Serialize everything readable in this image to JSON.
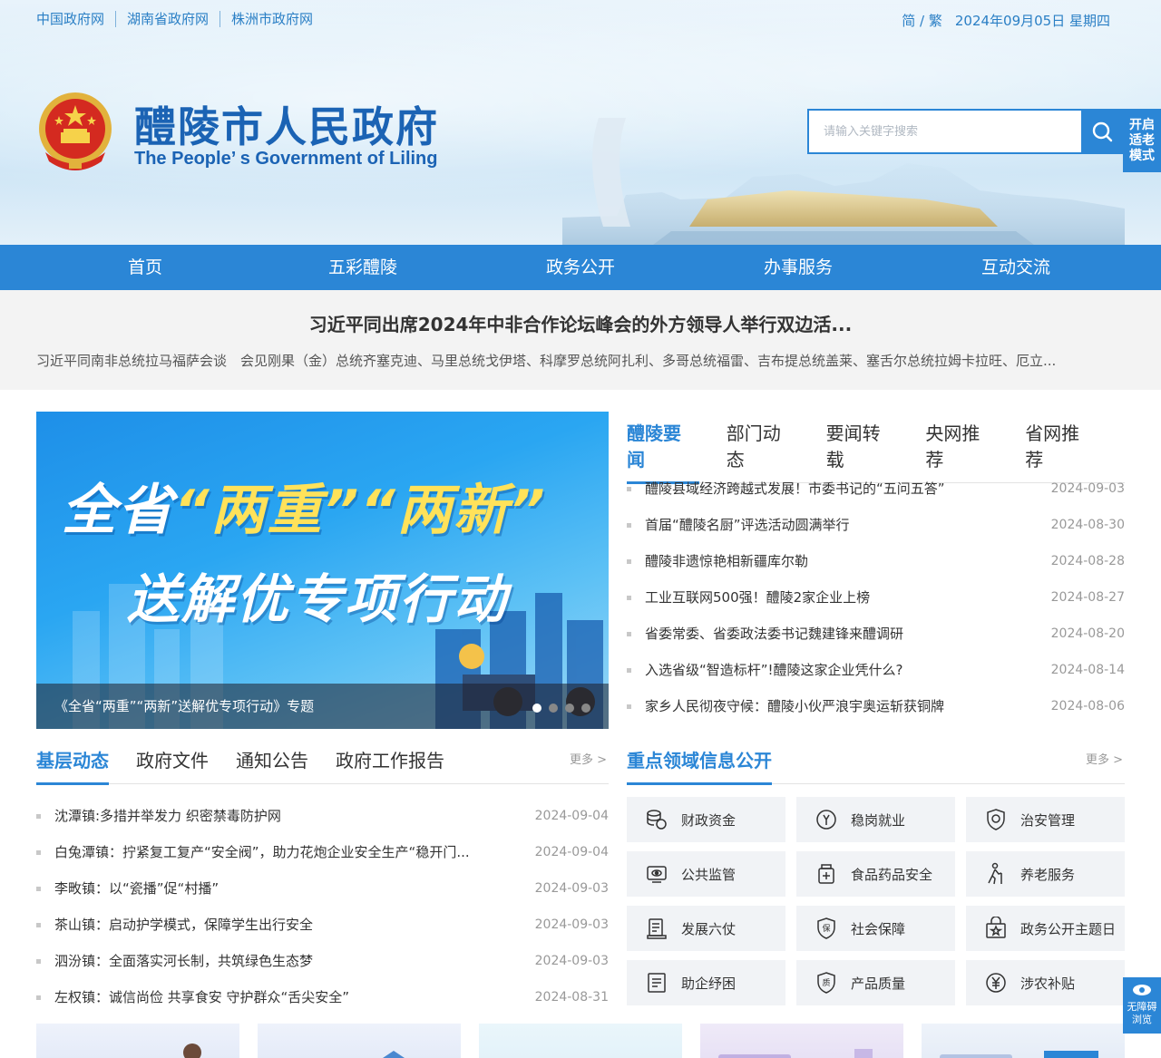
{
  "topbar": {
    "links": [
      "中国政府网",
      "湖南省政府网",
      "株洲市政府网"
    ],
    "lang": "简 / 繁",
    "date": "2024年09月05日 星期四"
  },
  "site": {
    "title_cn": "醴陵市人民政府",
    "title_en": "The People’ s Government of Liling"
  },
  "search": {
    "placeholder": "请输入关键字搜索",
    "icon": "search-icon"
  },
  "elder_mode": {
    "lines": [
      "开启",
      "适老",
      "模式"
    ]
  },
  "nav": [
    "首页",
    "五彩醴陵",
    "政务公开",
    "办事服务",
    "互动交流"
  ],
  "headline": {
    "title": "习近平同出席2024年中非合作论坛峰会的外方领导人举行双边活...",
    "sub": "习近平同南非总统拉马福萨会谈　会见刚果（金）总统齐塞克迪、马里总统戈伊塔、科摩罗总统阿扎利、多哥总统福雷、吉布提总统盖莱、塞舌尔总统拉姆卡拉旺、厄立..."
  },
  "banner": {
    "line1_a": "全省",
    "line1_b": "“两重”",
    "line1_c": "“两新”",
    "line2": "送解优专项行动",
    "caption": "《全省“两重”“两新”送解优专项行动》专题",
    "dots": 4
  },
  "news_tabs": [
    "醴陵要闻",
    "部门动态",
    "要闻转载",
    "央网推荐",
    "省网推荐"
  ],
  "news": [
    {
      "title": "醴陵县域经济跨越式发展！市委书记的“五问五答”",
      "date": "2024-09-03"
    },
    {
      "title": "首届“醴陵名厨”评选活动圆满举行",
      "date": "2024-08-30"
    },
    {
      "title": "醴陵非遗惊艳相新疆库尔勒",
      "date": "2024-08-28"
    },
    {
      "title": "工业互联网500强！醴陵2家企业上榜",
      "date": "2024-08-27"
    },
    {
      "title": "省委常委、省委政法委书记魏建锋来醴调研",
      "date": "2024-08-20"
    },
    {
      "title": "入选省级“智造标杆”!醴陵这家企业凭什么?",
      "date": "2024-08-14"
    },
    {
      "title": "家乡人民彻夜守候：醴陵小伙严浪宇奥运斩获铜牌",
      "date": "2024-08-06"
    }
  ],
  "grass_tabs": [
    "基层动态",
    "政府文件",
    "通知公告",
    "政府工作报告"
  ],
  "grass_more": "更多 >",
  "grass": [
    {
      "title": "沈潭镇:多措并举发力 织密禁毒防护网",
      "date": "2024-09-04"
    },
    {
      "title": "白兔潭镇：拧紧复工复产“安全阀”，助力花炮企业安全生产“稳开门...",
      "date": "2024-09-04"
    },
    {
      "title": "李畋镇：以“瓷播”促“村播”",
      "date": "2024-09-03"
    },
    {
      "title": "茶山镇：启动护学模式，保障学生出行安全",
      "date": "2024-09-03"
    },
    {
      "title": "泗汾镇：全面落实河长制，共筑绿色生态梦",
      "date": "2024-09-03"
    },
    {
      "title": "左权镇：诚信尚俭 共享食安 守护群众“舌尖安全”",
      "date": "2024-08-31"
    }
  ],
  "key_tab": "重点领域信息公开",
  "key_more": "更多 >",
  "key_items": [
    {
      "label": "财政资金",
      "icon": "coins-icon"
    },
    {
      "label": "稳岗就业",
      "icon": "badge-icon"
    },
    {
      "label": "治安管理",
      "icon": "shield-icon"
    },
    {
      "label": "公共监管",
      "icon": "eye-icon"
    },
    {
      "label": "食品药品安全",
      "icon": "medicine-icon"
    },
    {
      "label": "养老服务",
      "icon": "elder-icon"
    },
    {
      "label": "发展六仗",
      "icon": "document-icon"
    },
    {
      "label": "社会保障",
      "icon": "insurance-icon"
    },
    {
      "label": "政务公开主题日",
      "icon": "calendar-icon"
    },
    {
      "label": "助企纾困",
      "icon": "file-icon"
    },
    {
      "label": "产品质量",
      "icon": "quality-icon"
    },
    {
      "label": "涉农补贴",
      "icon": "yuan-icon"
    }
  ],
  "accessibility": {
    "lines": [
      "无障碍",
      "浏览"
    ]
  },
  "colors": {
    "primary": "#2b86d6",
    "title": "#1b63b4"
  }
}
